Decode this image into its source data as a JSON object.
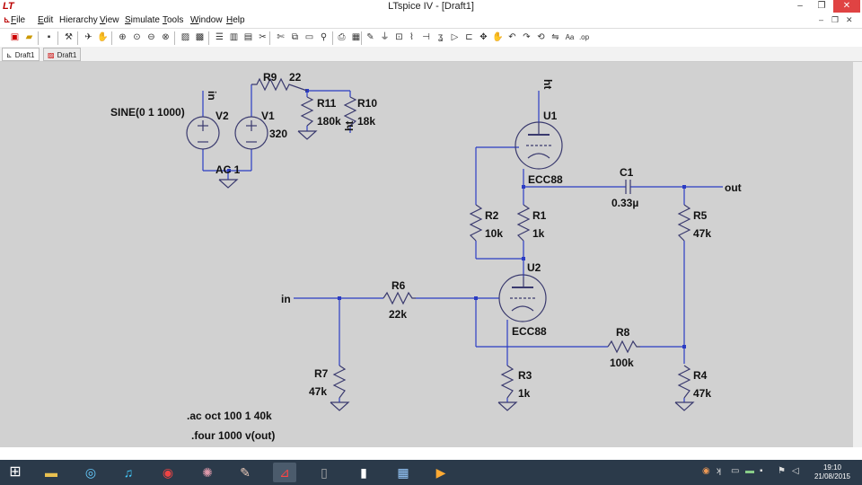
{
  "window": {
    "app_icon": "LT",
    "title": "LTspice IV - [Draft1]",
    "controls": [
      "–",
      "❐",
      "✕"
    ]
  },
  "menu": {
    "items": [
      {
        "u": "F",
        "rest": "ile"
      },
      {
        "u": "E",
        "rest": "dit"
      },
      {
        "u": "",
        "rest": "Hierarchy"
      },
      {
        "u": "V",
        "rest": "iew"
      },
      {
        "u": "S",
        "rest": "imulate"
      },
      {
        "u": "T",
        "rest": "ools"
      },
      {
        "u": "W",
        "rest": "indow"
      },
      {
        "u": "H",
        "rest": "elp"
      }
    ],
    "right_controls": [
      "–",
      "❐",
      "✕"
    ]
  },
  "tabs": [
    {
      "label": "Draft1",
      "icon": "schematic-icon"
    },
    {
      "label": "Draft1",
      "icon": "waveform-icon"
    }
  ],
  "schematic": {
    "labels": {
      "in_top": "in",
      "sine": "SINE(0 1 1000)",
      "v2": "V2",
      "v1": "V1",
      "v1_val": "320",
      "ac1": "AC 1",
      "r9": "R9",
      "r9_val": "22",
      "r11": "R11",
      "r11_val": "180k",
      "r10": "R10",
      "r10_val": "18k",
      "ht_left": "ht",
      "ht_top": "ht",
      "u1": "U1",
      "ecc88_1": "ECC88",
      "c1": "C1",
      "c1_val": "0.33µ",
      "out": "out",
      "r2": "R2",
      "r2_val": "10k",
      "r1": "R1",
      "r1_val": "1k",
      "r5": "R5",
      "r5_val": "47k",
      "u2": "U2",
      "ecc88_2": "ECC88",
      "in_mid": "in",
      "r6": "R6",
      "r6_val": "22k",
      "r8": "R8",
      "r8_val": "100k",
      "r7": "R7",
      "r7_val": "47k",
      "r3": "R3",
      "r3_val": "1k",
      "r4": "R4",
      "r4_val": "47k",
      "dir1": ".ac oct 100 1 40k",
      "dir2": ".four 1000 v(out)"
    }
  },
  "taskbar": {
    "clock_time": "19:10",
    "clock_date": "21/08/2015"
  },
  "colors": {
    "wire": "#2b3cc4",
    "component": "#3a3a6e",
    "background": "#d1d1d1"
  }
}
